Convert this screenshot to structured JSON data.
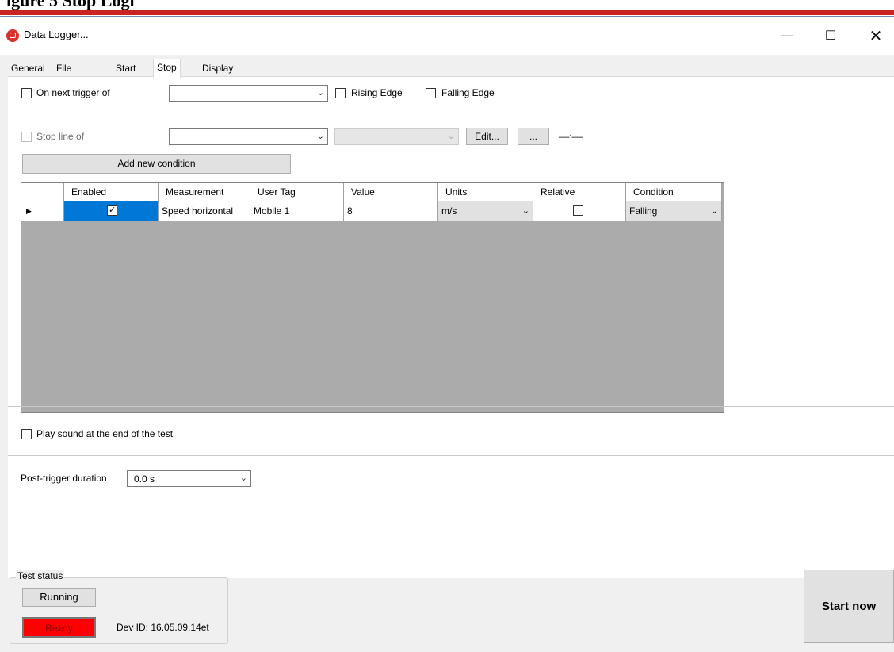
{
  "document": {
    "heading": "igure 5 Stop Logi"
  },
  "window": {
    "title": "Data Logger...",
    "minimize": "—",
    "maximize": "☐",
    "close": "✕"
  },
  "tabs": [
    {
      "label": "General"
    },
    {
      "label": "File"
    },
    {
      "label": "Start"
    },
    {
      "label": "Stop",
      "active": true
    },
    {
      "label": "Display"
    }
  ],
  "stop": {
    "trigger_label": "On next trigger of",
    "trigger_value": "",
    "rising_edge": "Rising Edge",
    "falling_edge": "Falling Edge",
    "stopline_label": "Stop line of",
    "stopline_value": "",
    "stopline_second_value": "",
    "edit_button": "Edit...",
    "ellipsis_button": "...",
    "line_preview": "__.__",
    "add_condition": "Add new condition"
  },
  "grid": {
    "columns": [
      "",
      "Enabled",
      "Measurement",
      "User Tag",
      "Value",
      "Units",
      "Relative",
      "Condition"
    ],
    "rows": [
      {
        "enabled": true,
        "measurement": "Speed horizontal",
        "user_tag": "Mobile 1",
        "value": "8",
        "units": "m/s",
        "relative": false,
        "condition": "Falling"
      }
    ]
  },
  "play_sound": "Play sound at the end of the test",
  "post_trigger": {
    "label": "Post-trigger duration",
    "value": "0.0 s"
  },
  "status": {
    "group_title": "Test status",
    "running": "Running",
    "ready": "Ready",
    "dev_id": "Dev ID: 16.05.09.14et"
  },
  "start_now": "Start now",
  "colors": {
    "accent_rule": "#cc2222",
    "selection": "#0078d7",
    "ready_bg": "#ff0000",
    "grid_bg": "#ababab"
  }
}
